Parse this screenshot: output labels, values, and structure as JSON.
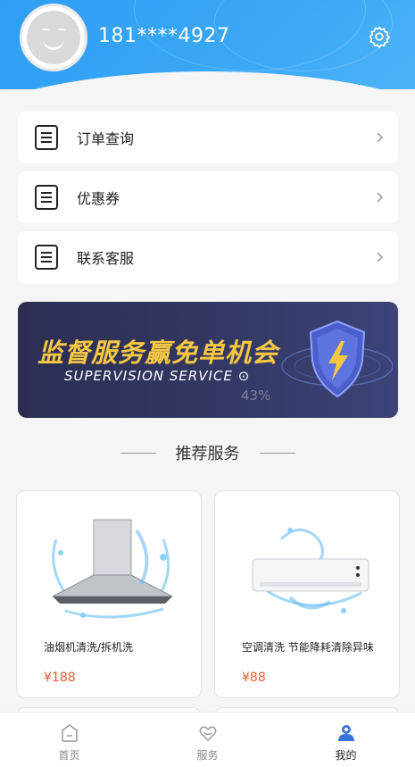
{
  "profile": {
    "phone": "181****4927"
  },
  "menu": [
    {
      "label": "订单查询",
      "icon": "list-icon"
    },
    {
      "label": "优惠券",
      "icon": "list-icon"
    },
    {
      "label": "联系客服",
      "icon": "list-icon"
    }
  ],
  "banner": {
    "title": "监督服务赢免单机会",
    "subtitle": "SUPERVISION SERVICE",
    "progress_text": "43%"
  },
  "recommend": {
    "title": "推荐服务"
  },
  "products": [
    {
      "name": "油烟机清洗/拆机洗",
      "price": "¥188"
    },
    {
      "name": "空调清洗  节能降耗清除异味",
      "price": "¥88"
    }
  ],
  "tabs": [
    {
      "label": "首页",
      "icon": "home-icon",
      "active": false
    },
    {
      "label": "服务",
      "icon": "service-heart-icon",
      "active": false
    },
    {
      "label": "我的",
      "icon": "user-icon",
      "active": true
    }
  ],
  "colors": {
    "header": "#3aa8f5",
    "price": "#f05b2a",
    "banner_gold": "#f7c742",
    "banner_bg": "#2b2d52"
  }
}
